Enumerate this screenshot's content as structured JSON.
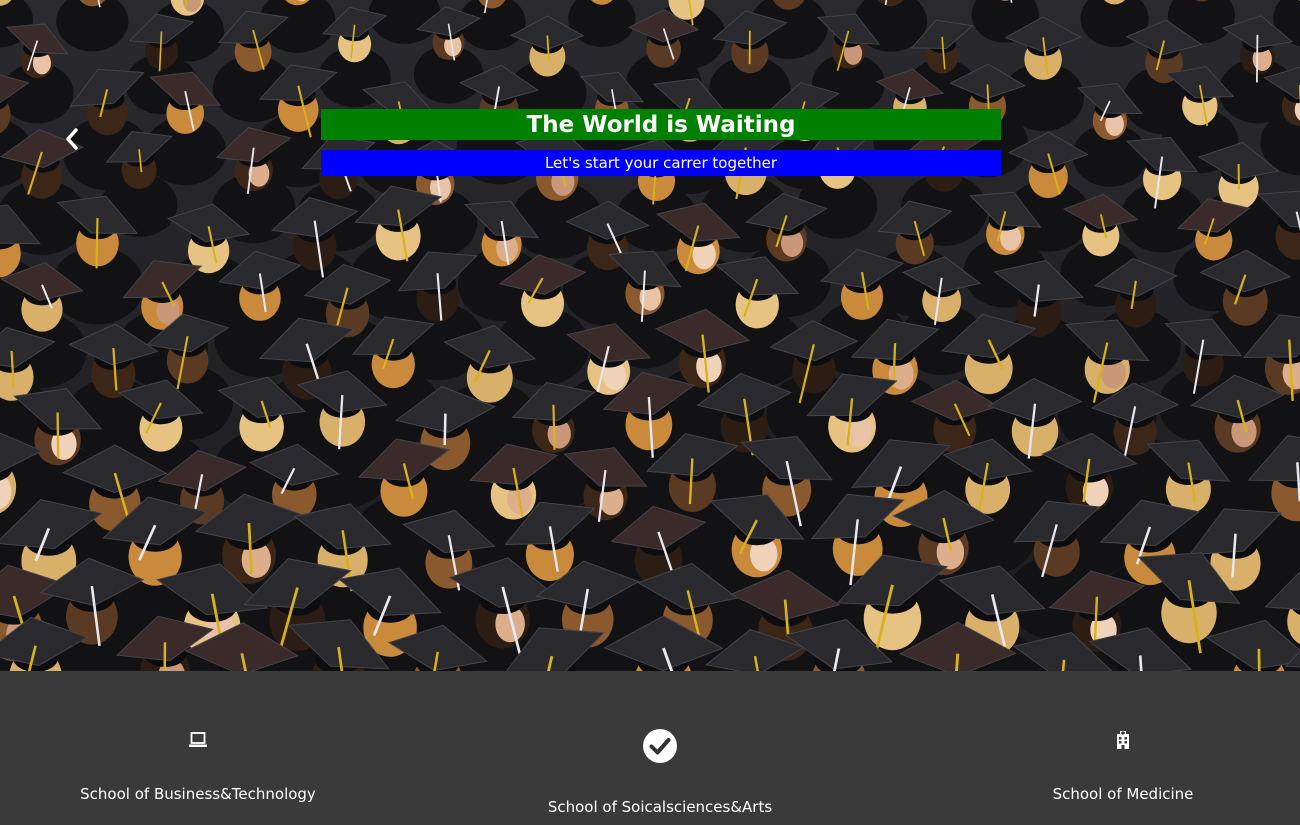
{
  "hero": {
    "title": "The World is Waiting",
    "subtitle": "Let's start your carrer together",
    "prev_icon": "chevron-left-icon",
    "background": "crowd of graduates in caps and gowns",
    "colors": {
      "title_bg": "#008000",
      "subtitle_bg": "#0000ff"
    }
  },
  "schools": [
    {
      "label": "School of Business&Technology",
      "icon": "laptop-icon"
    },
    {
      "label": "School of Soicalsciences&Arts",
      "icon": "check-circle-icon"
    },
    {
      "label": "School of Medicine",
      "icon": "hospital-icon"
    }
  ],
  "footer": {
    "background": "#3a3a3a"
  }
}
